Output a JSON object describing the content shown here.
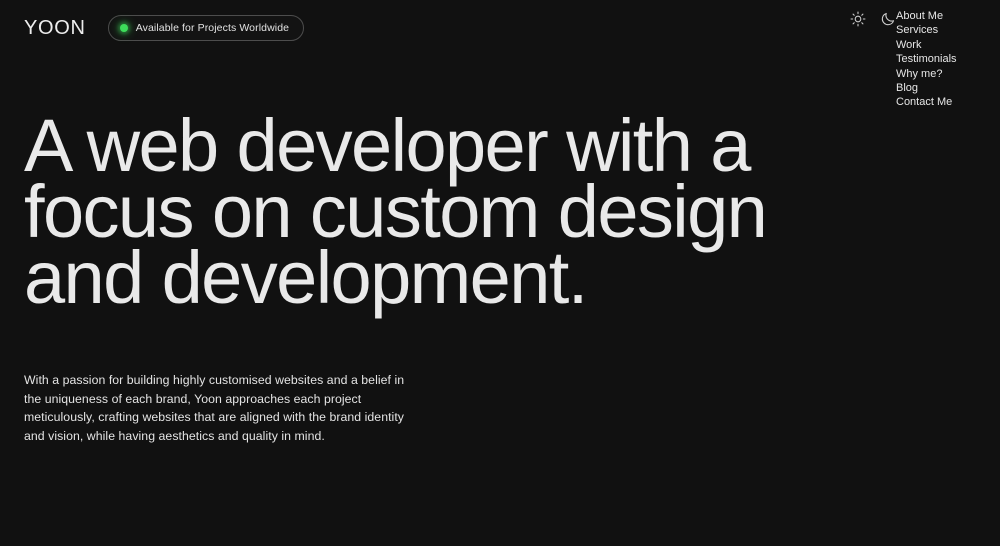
{
  "theme": {
    "background": "#111111",
    "text": "#e8e8e8",
    "accent_green": "#3ddc5a",
    "border": "#4d4d4d"
  },
  "header": {
    "logo": "YOON",
    "status": {
      "label": "Available for Projects Worldwide",
      "dot_color": "#3ddc5a"
    },
    "theme_toggle": {
      "light_icon": "sun-icon",
      "dark_icon": "moon-icon"
    }
  },
  "nav": {
    "items": [
      {
        "label": "About Me"
      },
      {
        "label": "Services"
      },
      {
        "label": "Work"
      },
      {
        "label": "Testimonials"
      },
      {
        "label": "Why me?"
      },
      {
        "label": "Blog"
      },
      {
        "label": "Contact Me"
      }
    ]
  },
  "hero": {
    "headline": "A web developer with a\nfocus on custom design\nand development.",
    "paragraph": "With a passion for building highly customised websites and a belief in the uniqueness of each brand, Yoon approaches each project meticulously, crafting websites that are aligned with the brand identity and vision, while having aesthetics and quality in mind."
  }
}
